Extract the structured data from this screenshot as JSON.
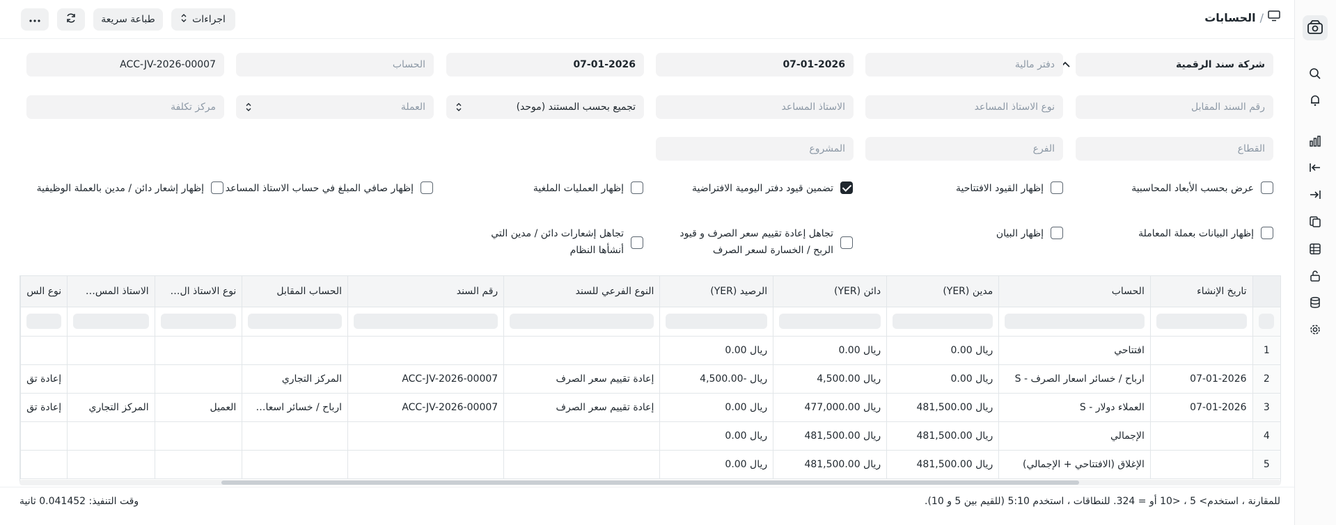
{
  "breadcrumb": {
    "title": "الحسابات"
  },
  "toolbar": {
    "actions_label": "اجراءات",
    "print_label": "طباعة سريعة"
  },
  "filters": {
    "company": "شركة سند الرقمية",
    "finance_book": "دفتر مالية",
    "from_date": "07-01-2026",
    "to_date": "07-01-2026",
    "account": "الحساب",
    "voucher_no": "ACC-JV-2026-00007",
    "against_voucher": "رقم السند المقابل",
    "party_type": "نوع الاستاذ المساعد",
    "party": "الاستاذ المساعد",
    "group_by": "تجميع بحسب المستند (موحد)",
    "currency": "العملة",
    "cost_center": "مركز تكلفة",
    "sector": "القطاع",
    "branch": "الفرع",
    "project": "المشروع"
  },
  "checkboxes": [
    {
      "label": "عرض بحسب الأبعاد المحاسبية",
      "checked": false
    },
    {
      "label": "إظهار القيود الافتتاحية",
      "checked": false
    },
    {
      "label": "تضمين قيود دفتر اليومية الافتراضية",
      "checked": true
    },
    {
      "label": "إظهار العمليات الملغية",
      "checked": false
    },
    {
      "label": "إظهار صافي المبلغ في حساب الاستاذ المساعد",
      "checked": false
    },
    {
      "label": "إظهار إشعار دائن / مدين بالعملة الوظيفية",
      "checked": false
    },
    {
      "label": "إظهار البيانات بعملة المعاملة",
      "checked": false
    },
    {
      "label": "إظهار البيان",
      "checked": false
    },
    {
      "label": "تجاهل إعادة تقييم سعر الصرف و قيود الربح / الخسارة لسعر الصرف",
      "checked": false
    },
    {
      "label": "تجاهل إشعارات دائن / مدين التي أنشأها النظام",
      "checked": false
    }
  ],
  "table": {
    "columns": [
      "تاريخ الإنشاء",
      "الحساب",
      "مدين (YER)",
      "دائن (YER)",
      "الرصيد (YER)",
      "النوع الفرعي للسند",
      "رقم السند",
      "الحساب المقابل",
      "نوع الاستاذ ال…",
      "الاستاذ المس…",
      "نوع الس"
    ],
    "rows": [
      {
        "idx": "1",
        "cells": [
          "",
          "افتتاحي",
          "ريال 0.00",
          "ريال 0.00",
          "ريال 0.00",
          "",
          "",
          "",
          "",
          "",
          ""
        ]
      },
      {
        "idx": "2",
        "cells": [
          "07-01-2026",
          "ارباح / خسائر اسعار الصرف - S",
          "ريال 0.00",
          "ريال 4,500.00",
          "ريال -4,500.00",
          "إعادة تقييم سعر الصرف",
          "ACC-JV-2026-00007",
          "المركز التجاري",
          "",
          "",
          "إعادة تق"
        ]
      },
      {
        "idx": "3",
        "cells": [
          "07-01-2026",
          "العملاء دولار - S",
          "ريال 481,500.00",
          "ريال 477,000.00",
          "ريال 0.00",
          "إعادة تقييم سعر الصرف",
          "ACC-JV-2026-00007",
          "ارباح / خسائر اسعا…",
          "العميل",
          "المركز التجاري",
          "إعادة تق"
        ]
      },
      {
        "idx": "4",
        "cells": [
          "",
          "الإجمالي",
          "ريال 481,500.00",
          "ريال 481,500.00",
          "ريال 0.00",
          "",
          "",
          "",
          "",
          "",
          ""
        ]
      },
      {
        "idx": "5",
        "cells": [
          "",
          "الإغلاق (الافتتاحي + الإجمالي)",
          "ريال 481,500.00",
          "ريال 481,500.00",
          "ريال 0.00",
          "",
          "",
          "",
          "",
          "",
          ""
        ]
      }
    ]
  },
  "footer": {
    "hint": "للمقارنة ، استخدم> 5 ، <10 أو = 324. للنطاقات ، استخدم 5:10 (للقيم بين 5 و 10).",
    "exec_time": "وقت التنفيذ: 0.041452 ثانية"
  }
}
